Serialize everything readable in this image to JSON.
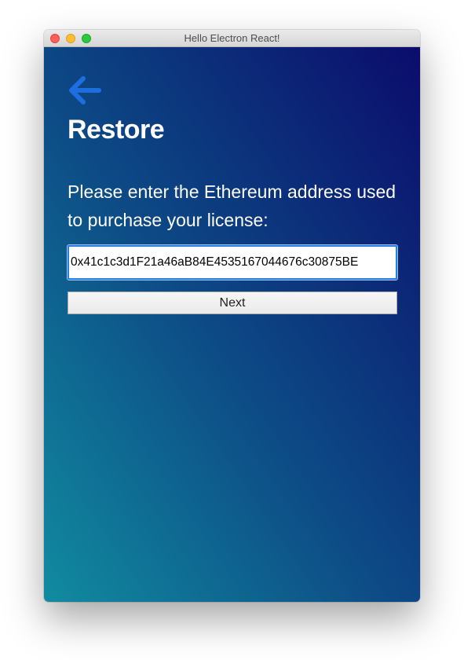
{
  "window": {
    "title": "Hello Electron React!",
    "controls": [
      "close",
      "minimize",
      "zoom"
    ]
  },
  "header": {
    "back_icon": "arrow-left-icon",
    "title": "Restore"
  },
  "form": {
    "prompt": "Please enter the Ethereum address used to purchase your license:",
    "address_value": "0x41c1c3d1F21a46aB84E4535167044676c30875BE",
    "next_label": "Next"
  },
  "colors": {
    "gradient_bottom_left": "#118ba0",
    "gradient_top_right": "#0b0c6c",
    "accent": "#2a7de1",
    "back_arrow": "#1d6fe0",
    "text": "#ffffff"
  }
}
